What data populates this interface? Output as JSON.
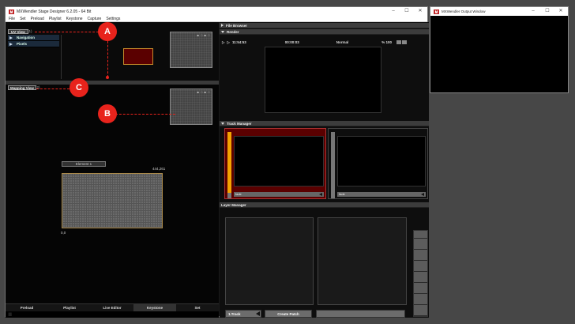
{
  "main_window": {
    "title": "MXWendler Stage Designer 6.2.05 - 64 Bit",
    "controls": {
      "minimize": "–",
      "maximize": "☐",
      "close": "✕"
    },
    "menu": [
      "File",
      "Set",
      "Preload",
      "Playlist",
      "Keystone",
      "Capture",
      "Settings"
    ]
  },
  "uv_view": {
    "tab_label": "UV View",
    "tab_count": "(1)",
    "nav_items": [
      "Navigation",
      "Pixels"
    ],
    "preview_dots": "■ □ ■ □"
  },
  "mapping_view": {
    "tab_label": "Mapping View",
    "tab_count": "(2)",
    "element_label": "Element 1",
    "coord_top": "444,261",
    "coord_bottom": "0,0",
    "preview_dots": "■ □ ■ □"
  },
  "bottom_tabs": [
    "Preload",
    "Playlist",
    "Live Editor",
    "Keystone",
    "Set"
  ],
  "active_bottom_tab": "Keystone",
  "statusbar": "| |",
  "file_browser": {
    "label": "File Browser"
  },
  "render": {
    "label": "Render",
    "clock": "11:54:53",
    "time": "00:00:03",
    "mode": "Normal",
    "zoom": "% 100"
  },
  "track_manager": {
    "label": "Track Manager",
    "tracks": [
      {
        "foot": "fade",
        "selected": true,
        "level": 0.92
      },
      {
        "foot": "fade",
        "selected": false,
        "level": 0.0
      }
    ]
  },
  "layer_manager": {
    "label": "Layer Manager",
    "track_button": "1.Track",
    "create_patch": "Create Patch"
  },
  "output_window": {
    "title": "MXWendler Output Window",
    "controls": {
      "minimize": "–",
      "maximize": "☐",
      "close": "✕"
    }
  },
  "annotations": [
    "A",
    "B",
    "C"
  ],
  "colors": {
    "annotation": "#e8231c",
    "track_selected": "#5a0000",
    "level": "#f5a300"
  }
}
